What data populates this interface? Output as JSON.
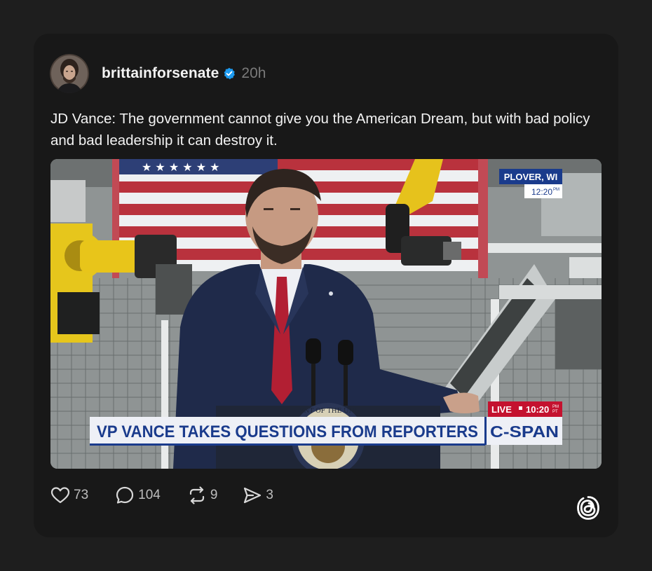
{
  "post": {
    "username": "brittainforsenate",
    "time": "20h",
    "text": "JD Vance: The government cannot give you the American Dream, but with bad policy and bad leadership it can destroy it."
  },
  "media": {
    "location": "PLOVER, WI",
    "clock": "12:20",
    "clock_suffix": "PM",
    "live": "LIVE",
    "live_time": "10:20",
    "live_zone_top": "PM",
    "live_zone_bottom": "PT",
    "lower_third": "VP VANCE TAKES QUESTIONS FROM REPORTERS",
    "network": "C-SPAN",
    "seal_text": "ENT OF THE UNI"
  },
  "actions": {
    "likes": "73",
    "comments": "104",
    "reposts": "9",
    "shares": "3"
  },
  "icons": {
    "like": "heart-icon",
    "comment": "comment-bubble-icon",
    "repost": "repost-icon",
    "share": "send-icon",
    "brand": "threads-logo-icon",
    "verified": "verified-badge-icon"
  },
  "colors": {
    "background": "#1e1e1e",
    "card": "#181818",
    "verified": "#1d9bf0",
    "cspan_blue": "#1a3b8c",
    "live_red": "#c4122f"
  }
}
